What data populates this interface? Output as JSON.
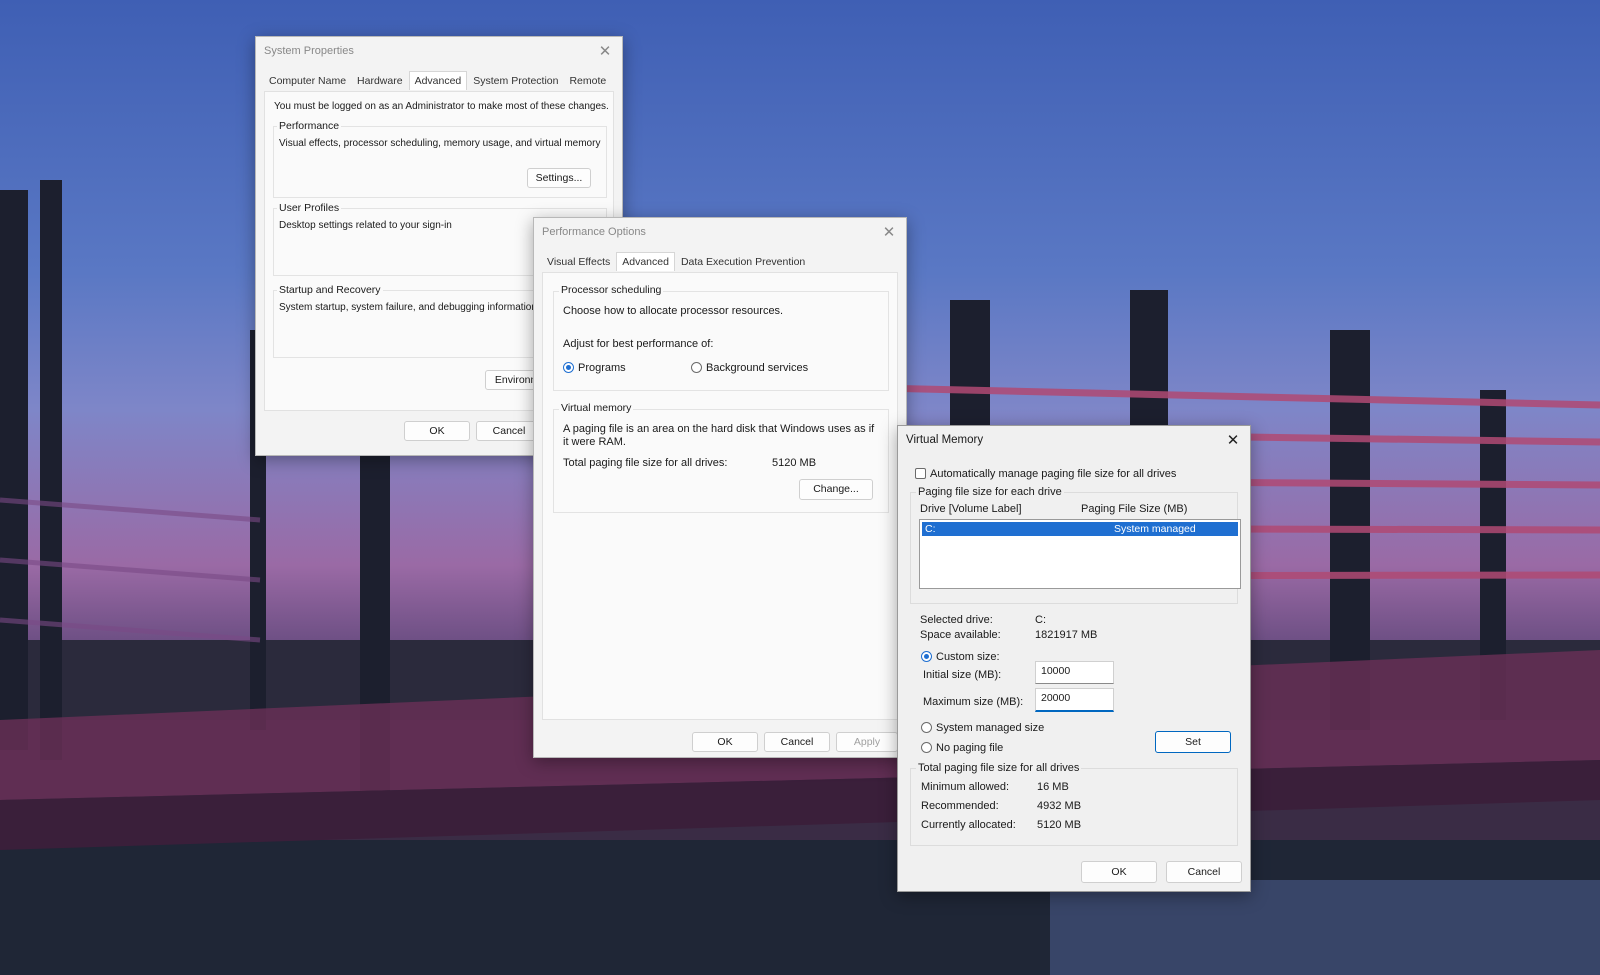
{
  "system_properties": {
    "title": "System Properties",
    "tabs": [
      "Computer Name",
      "Hardware",
      "Advanced",
      "System Protection",
      "Remote"
    ],
    "admin_note": "You must be logged on as an Administrator to make most of these changes.",
    "performance": {
      "label": "Performance",
      "desc": "Visual effects, processor scheduling, memory usage, and virtual memory",
      "settings_button": "Settings..."
    },
    "user_profiles": {
      "label": "User Profiles",
      "desc": "Desktop settings related to your sign-in"
    },
    "startup_recovery": {
      "label": "Startup and Recovery",
      "desc": "System startup, system failure, and debugging information"
    },
    "env_button": "Environme",
    "ok_button": "OK",
    "cancel_button": "Cancel"
  },
  "performance_options": {
    "title": "Performance Options",
    "tabs": [
      "Visual Effects",
      "Advanced",
      "Data Execution Prevention"
    ],
    "processor": {
      "label": "Processor scheduling",
      "desc": "Choose how to allocate processor resources.",
      "adjust": "Adjust for best performance of:",
      "programs": "Programs",
      "background": "Background services",
      "selected": "Programs"
    },
    "virtual_memory": {
      "label": "Virtual memory",
      "desc": "A paging file is an area on the hard disk that Windows uses as if it were RAM.",
      "total_label": "Total paging file size for all drives:",
      "total_value": "5120 MB",
      "change_button": "Change..."
    },
    "ok_button": "OK",
    "cancel_button": "Cancel",
    "apply_button": "Apply"
  },
  "virtual_memory": {
    "title": "Virtual Memory",
    "auto_manage": {
      "label": "Automatically manage paging file size for all drives",
      "checked": false
    },
    "paging_group_label": "Paging file size for each drive",
    "col_drive": "Drive  [Volume Label]",
    "col_size": "Paging File Size (MB)",
    "drives": [
      {
        "drive": "C:",
        "size": "System managed"
      }
    ],
    "selected_drive_label": "Selected drive:",
    "selected_drive_value": "C:",
    "space_label": "Space available:",
    "space_value": "1821917 MB",
    "custom_size": "Custom size:",
    "initial_label": "Initial size (MB):",
    "initial_value": "10000",
    "maximum_label": "Maximum size (MB):",
    "maximum_value": "20000",
    "system_managed": "System managed size",
    "no_paging": "No paging file",
    "set_button": "Set",
    "total_group_label": "Total paging file size for all drives",
    "min_label": "Minimum allowed:",
    "min_value": "16 MB",
    "rec_label": "Recommended:",
    "rec_value": "4932 MB",
    "cur_label": "Currently allocated:",
    "cur_value": "5120 MB",
    "ok_button": "OK",
    "cancel_button": "Cancel"
  },
  "icons": {
    "close": "close-icon"
  },
  "colors": {
    "accent": "#1f6fd1",
    "dialog_bg": "#f3f3f3"
  }
}
